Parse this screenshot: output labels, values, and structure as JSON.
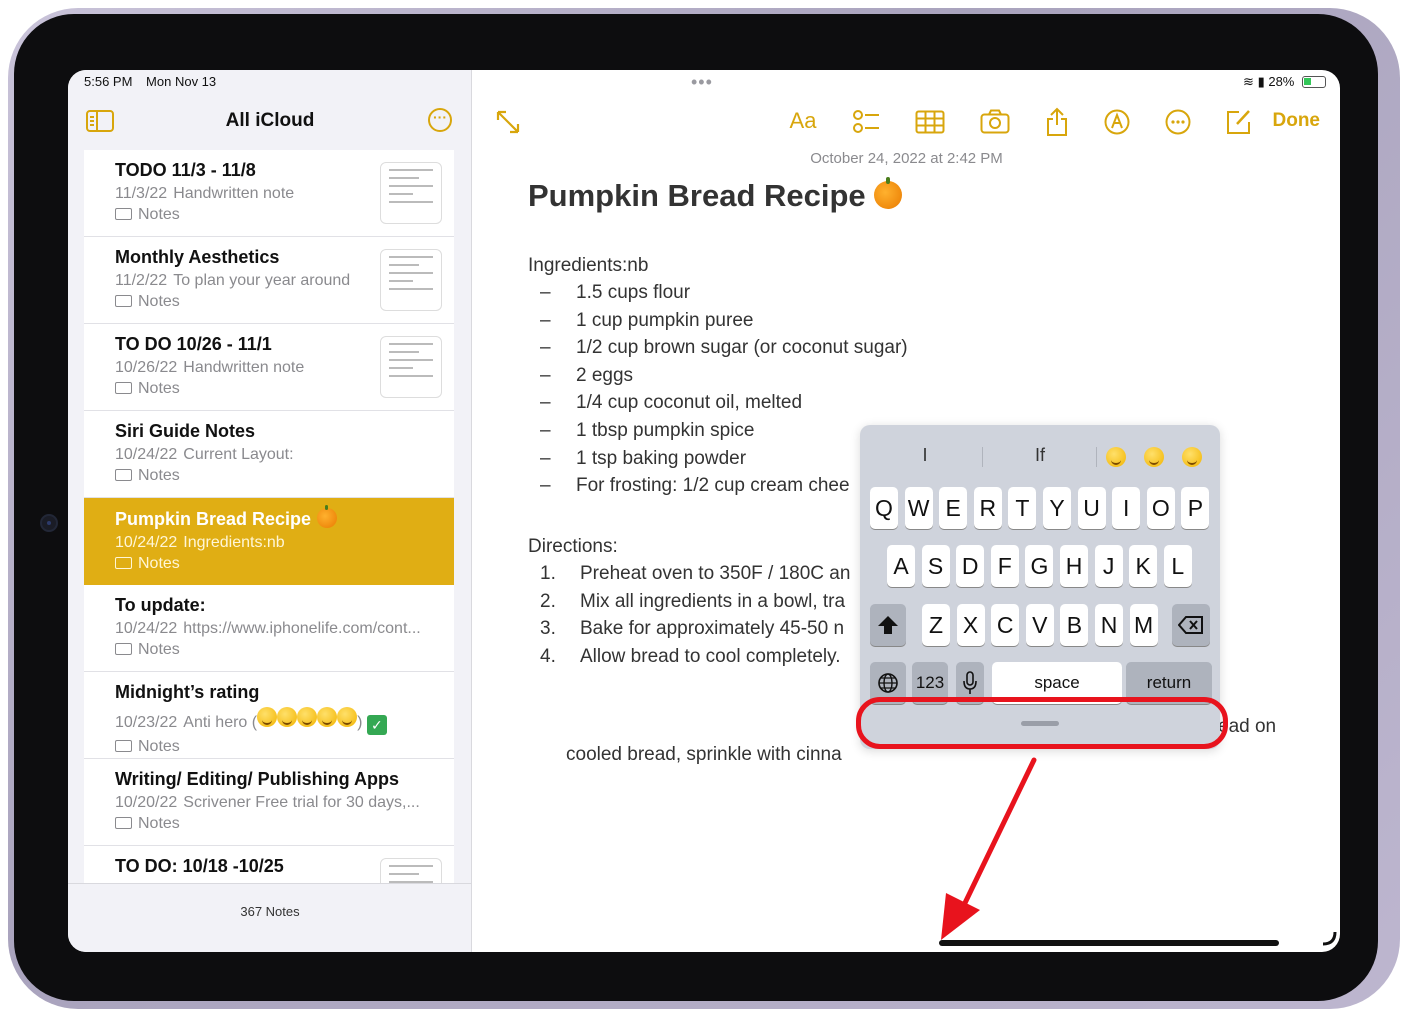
{
  "status": {
    "time": "5:56 PM",
    "date": "Mon Nov 13",
    "battery": "28%"
  },
  "sidebar": {
    "title": "All iCloud",
    "count": "367 Notes",
    "notes": [
      {
        "title": "TODO 11/3 - 11/8",
        "date": "11/3/22",
        "preview": "Handwritten note",
        "folder": "Notes",
        "thumb": true
      },
      {
        "title": "Monthly Aesthetics",
        "date": "11/2/22",
        "preview": "To plan your year around",
        "folder": "Notes",
        "thumb": true
      },
      {
        "title": "TO DO 10/26 - 11/1",
        "date": "10/26/22",
        "preview": "Handwritten note",
        "folder": "Notes",
        "thumb": true
      },
      {
        "title": "Siri Guide Notes",
        "date": "10/24/22",
        "preview": "Current Layout:",
        "folder": "Notes"
      },
      {
        "title": "Pumpkin Bread Recipe",
        "date": "10/24/22",
        "preview": "Ingredients:nb",
        "folder": "Notes",
        "selected": true
      },
      {
        "title": "To update:",
        "date": "10/24/22",
        "preview": "https://www.iphonelife.com/cont...",
        "folder": "Notes"
      },
      {
        "title": "Midnight’s rating",
        "date": "10/23/22",
        "preview": "Anti hero (",
        "preview_end": ")",
        "folder": "Notes"
      },
      {
        "title": "Writing/ Editing/ Publishing Apps",
        "date": "10/20/22",
        "preview": "Scrivener Free trial for 30 days,...",
        "folder": "Notes"
      },
      {
        "title": "TO DO: 10/18 -10/25",
        "date": "",
        "preview": "",
        "folder": "",
        "thumb": true
      }
    ]
  },
  "toolbar": {
    "format": "Aa",
    "done": "Done"
  },
  "note": {
    "date": "October 24, 2022 at 2:42 PM",
    "title": "Pumpkin Bread Recipe",
    "ingredients_label": "Ingredients:nb",
    "ingredients": [
      "1.5 cups flour",
      "1 cup pumpkin puree",
      "1/2 cup brown sugar (or coconut sugar)",
      "2 eggs",
      "1/4 cup coconut oil, melted",
      "1 tbsp pumpkin spice",
      "1 tsp baking powder",
      "For frosting: 1/2 cup cream chee"
    ],
    "directions_label": "Directions:",
    "directions": [
      {
        "num": "1.",
        "text": "Preheat oven to 350F / 180C an"
      },
      {
        "num": "2.",
        "text": "Mix all ingredients in a bowl, tra"
      },
      {
        "num": "3.",
        "text": "Bake for approximately 45-50 n"
      },
      {
        "num": "4.",
        "text": "Allow bread to cool completely."
      }
    ],
    "direction_4_tail": "ead on",
    "direction_4_cont": "cooled bread, sprinkle with cinna"
  },
  "keyboard": {
    "predictions": [
      "I",
      "If"
    ],
    "row1": [
      "Q",
      "W",
      "E",
      "R",
      "T",
      "Y",
      "U",
      "I",
      "O",
      "P"
    ],
    "row2": [
      "A",
      "S",
      "D",
      "F",
      "G",
      "H",
      "J",
      "K",
      "L"
    ],
    "row3": [
      "Z",
      "X",
      "C",
      "V",
      "B",
      "N",
      "M"
    ],
    "numbers_key": "123",
    "space": "space",
    "return": "return"
  },
  "colors": {
    "accent": "#d8a60c",
    "selected_row": "#e0ae14",
    "annotation": "#e8131d"
  }
}
